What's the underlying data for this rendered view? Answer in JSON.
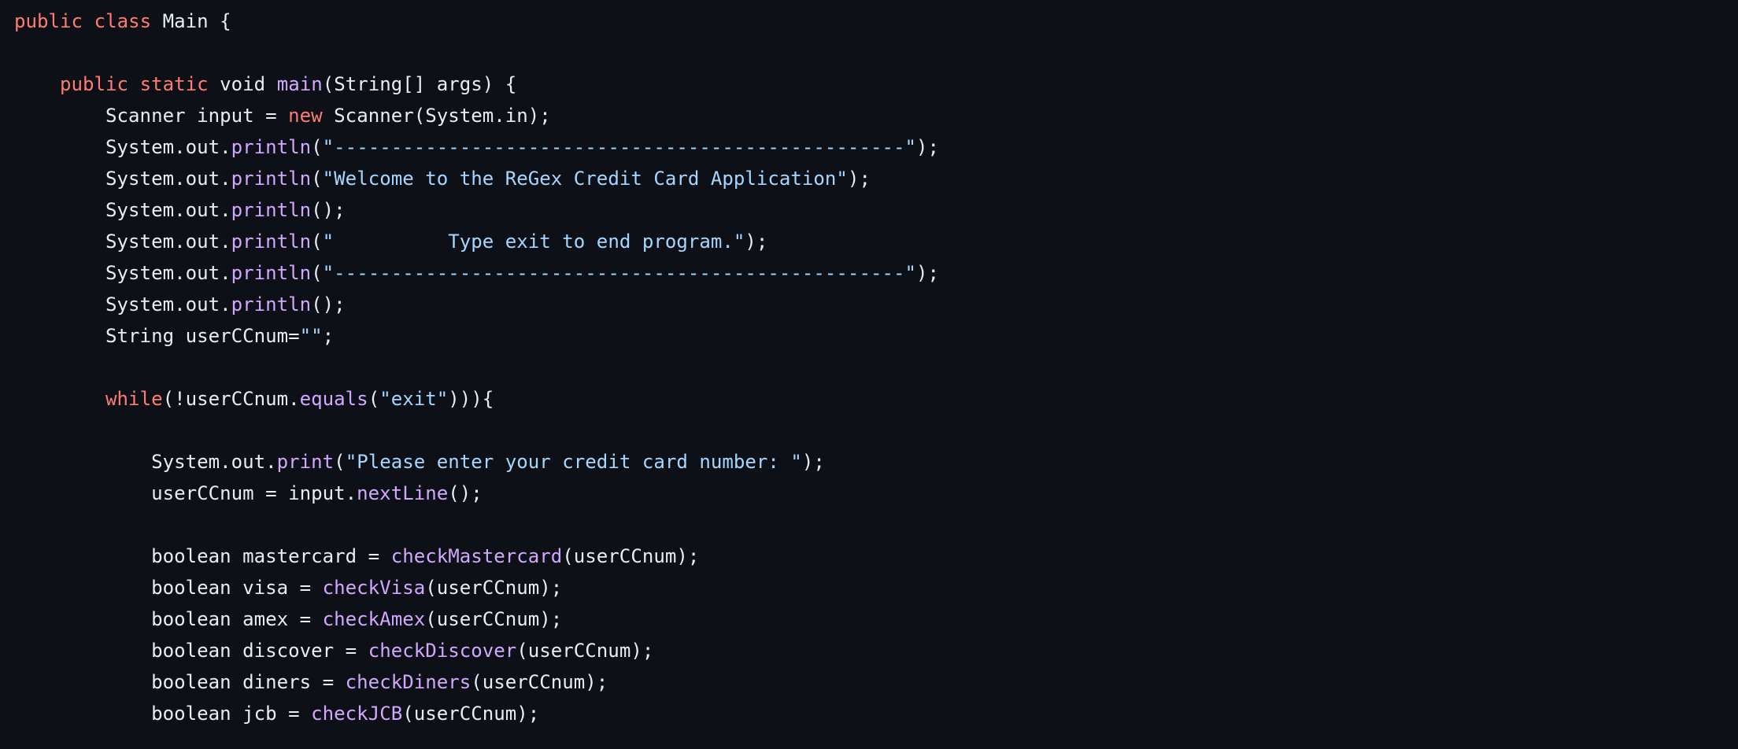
{
  "editor": {
    "language": "java",
    "theme": {
      "background": "#0d1117",
      "plain": "#e6edf3",
      "keyword": "#ff7b72",
      "function": "#d2a8ff",
      "string": "#a5d6ff"
    },
    "lines": [
      [
        [
          "kw",
          "public"
        ],
        [
          "p",
          " "
        ],
        [
          "kw",
          "class"
        ],
        [
          "p",
          " Main {"
        ]
      ],
      [],
      [
        [
          "p",
          "    "
        ],
        [
          "kw",
          "public"
        ],
        [
          "p",
          " "
        ],
        [
          "kw",
          "static"
        ],
        [
          "p",
          " void "
        ],
        [
          "fn",
          "main"
        ],
        [
          "p",
          "(String[] args) {"
        ]
      ],
      [
        [
          "p",
          "        Scanner input = "
        ],
        [
          "kw",
          "new"
        ],
        [
          "p",
          " Scanner(System.in);"
        ]
      ],
      [
        [
          "p",
          "        System.out."
        ],
        [
          "fn",
          "println"
        ],
        [
          "p",
          "("
        ],
        [
          "str",
          "\"--------------------------------------------------\""
        ],
        [
          "p",
          ");"
        ]
      ],
      [
        [
          "p",
          "        System.out."
        ],
        [
          "fn",
          "println"
        ],
        [
          "p",
          "("
        ],
        [
          "str",
          "\"Welcome to the ReGex Credit Card Application\""
        ],
        [
          "p",
          ");"
        ]
      ],
      [
        [
          "p",
          "        System.out."
        ],
        [
          "fn",
          "println"
        ],
        [
          "p",
          "();"
        ]
      ],
      [
        [
          "p",
          "        System.out."
        ],
        [
          "fn",
          "println"
        ],
        [
          "p",
          "("
        ],
        [
          "str",
          "\"          Type exit to end program.\""
        ],
        [
          "p",
          ");"
        ]
      ],
      [
        [
          "p",
          "        System.out."
        ],
        [
          "fn",
          "println"
        ],
        [
          "p",
          "("
        ],
        [
          "str",
          "\"--------------------------------------------------\""
        ],
        [
          "p",
          ");"
        ]
      ],
      [
        [
          "p",
          "        System.out."
        ],
        [
          "fn",
          "println"
        ],
        [
          "p",
          "();"
        ]
      ],
      [
        [
          "p",
          "        String userCCnum="
        ],
        [
          "str",
          "\"\""
        ],
        [
          "p",
          ";"
        ]
      ],
      [],
      [
        [
          "p",
          "        "
        ],
        [
          "kw",
          "while"
        ],
        [
          "p",
          "(!userCCnum."
        ],
        [
          "fn",
          "equals"
        ],
        [
          "p",
          "("
        ],
        [
          "str",
          "\"exit\""
        ],
        [
          "p",
          "))){"
        ]
      ],
      [],
      [
        [
          "p",
          "            System.out."
        ],
        [
          "fn",
          "print"
        ],
        [
          "p",
          "("
        ],
        [
          "str",
          "\"Please enter your credit card number: \""
        ],
        [
          "p",
          ");"
        ]
      ],
      [
        [
          "p",
          "            userCCnum = input."
        ],
        [
          "fn",
          "nextLine"
        ],
        [
          "p",
          "();"
        ]
      ],
      [],
      [
        [
          "p",
          "            boolean mastercard = "
        ],
        [
          "fn",
          "checkMastercard"
        ],
        [
          "p",
          "(userCCnum);"
        ]
      ],
      [
        [
          "p",
          "            boolean visa = "
        ],
        [
          "fn",
          "checkVisa"
        ],
        [
          "p",
          "(userCCnum);"
        ]
      ],
      [
        [
          "p",
          "            boolean amex = "
        ],
        [
          "fn",
          "checkAmex"
        ],
        [
          "p",
          "(userCCnum);"
        ]
      ],
      [
        [
          "p",
          "            boolean discover = "
        ],
        [
          "fn",
          "checkDiscover"
        ],
        [
          "p",
          "(userCCnum);"
        ]
      ],
      [
        [
          "p",
          "            boolean diners = "
        ],
        [
          "fn",
          "checkDiners"
        ],
        [
          "p",
          "(userCCnum);"
        ]
      ],
      [
        [
          "p",
          "            boolean jcb = "
        ],
        [
          "fn",
          "checkJCB"
        ],
        [
          "p",
          "(userCCnum);"
        ]
      ]
    ]
  }
}
